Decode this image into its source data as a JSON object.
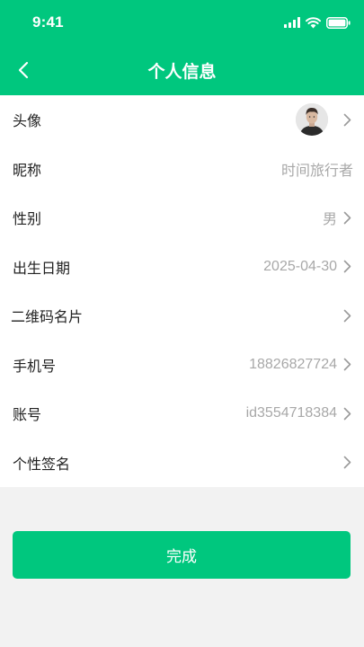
{
  "status_bar": {
    "time": "9:41",
    "icons": [
      "signal-icon",
      "wifi-icon",
      "battery-icon"
    ]
  },
  "nav": {
    "title": "个人信息",
    "back_icon": "chevron-left-icon"
  },
  "rows": [
    {
      "label": "头像",
      "value": "",
      "has_avatar": true,
      "chevron": true
    },
    {
      "label": "昵称",
      "value": "时间旅行者",
      "chevron": false
    },
    {
      "label": "性别",
      "value": "男",
      "chevron": true
    },
    {
      "label": "出生日期",
      "value": "2025-04-30",
      "chevron": true
    },
    {
      "label": "二维码名片",
      "value": "",
      "chevron": true
    },
    {
      "label": "手机号",
      "value": "18826827724",
      "chevron": true
    },
    {
      "label": "账号",
      "value": "id3554718384",
      "chevron": true
    },
    {
      "label": "个性签名",
      "value": "",
      "chevron": true
    }
  ],
  "done_button": {
    "label": "完成"
  },
  "colors": {
    "brand_green": "#00c77e",
    "background": "#f2f2f2",
    "value_gray": "#a8a8a8"
  }
}
